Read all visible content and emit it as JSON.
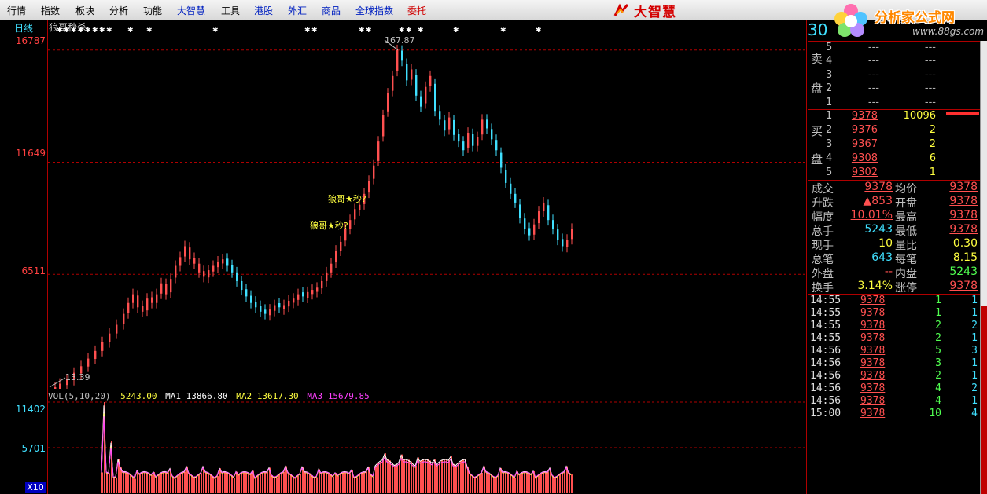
{
  "menu": {
    "items": [
      {
        "label": "行情",
        "style": "normal"
      },
      {
        "label": "指数",
        "style": "normal"
      },
      {
        "label": "板块",
        "style": "normal"
      },
      {
        "label": "分析",
        "style": "normal"
      },
      {
        "label": "功能",
        "style": "normal"
      },
      {
        "label": "大智慧",
        "style": "blue"
      },
      {
        "label": "工具",
        "style": "normal"
      },
      {
        "label": "港股",
        "style": "blue"
      },
      {
        "label": "外汇",
        "style": "blue"
      },
      {
        "label": "商品",
        "style": "blue"
      },
      {
        "label": "全球指数",
        "style": "blue"
      },
      {
        "label": "委托",
        "style": "red"
      }
    ],
    "brand": "大智慧"
  },
  "logo": {
    "title": "分析家公式网",
    "url": "www.88gs.com"
  },
  "chart": {
    "period_tab": "日线",
    "stock_title": "狼哥秒杀",
    "y_labels": [
      "16787",
      "11649",
      "6511"
    ],
    "high_label": "167.87",
    "low_label": "13.39",
    "signal_text": "狼哥★秒?",
    "vol_header": {
      "name": "VOL(5,10,20)",
      "vol": "5243.00",
      "ma1_label": "MA1",
      "ma1": "13866.80",
      "ma2_label": "MA2",
      "ma2": "13617.30",
      "ma3_label": "MA3",
      "ma3": "15679.85"
    },
    "vol_y_labels": [
      "11402",
      "5701"
    ],
    "vol_scale": "X10",
    "colors": {
      "up": "#ff5050",
      "down": "#40e0ff",
      "ma1": "#ffffff",
      "ma2": "#ffff40",
      "ma3": "#ff40ff",
      "grid": "#b00000"
    }
  },
  "chart_data": {
    "type": "candlestick",
    "ylim": [
      1339,
      17500
    ],
    "y_ticks": [
      6511,
      11649,
      16787
    ],
    "high": 16787,
    "low": 1339,
    "vol_ylim": [
      0,
      11402
    ],
    "vol_ticks": [
      5701,
      11402
    ]
  },
  "quote": {
    "code": "30",
    "sell_caption_1": "卖",
    "sell_caption_2": "盘",
    "buy_caption_1": "买",
    "buy_caption_2": "盘",
    "sell": [
      {
        "level": "5",
        "price": "---",
        "vol": "---"
      },
      {
        "level": "4",
        "price": "---",
        "vol": "---"
      },
      {
        "level": "3",
        "price": "---",
        "vol": "---"
      },
      {
        "level": "2",
        "price": "---",
        "vol": "---"
      },
      {
        "level": "1",
        "price": "---",
        "vol": "---"
      }
    ],
    "buy": [
      {
        "level": "1",
        "price": "9378",
        "vol": "10096"
      },
      {
        "level": "2",
        "price": "9376",
        "vol": "2"
      },
      {
        "level": "3",
        "price": "9367",
        "vol": "2"
      },
      {
        "level": "4",
        "price": "9308",
        "vol": "6"
      },
      {
        "level": "5",
        "price": "9302",
        "vol": "1"
      }
    ],
    "info": [
      {
        "l1": "成交",
        "v1": "9378",
        "c1": "red",
        "l2": "均价",
        "v2": "9378",
        "c2": "red"
      },
      {
        "l1": "升跌",
        "v1": "▲853",
        "c1": "red",
        "l2": "开盘",
        "v2": "9378",
        "c2": "red"
      },
      {
        "l1": "幅度",
        "v1": "10.01%",
        "c1": "red",
        "l2": "最高",
        "v2": "9378",
        "c2": "red"
      },
      {
        "l1": "总手",
        "v1": "5243",
        "c1": "cyan",
        "l2": "最低",
        "v2": "9378",
        "c2": "red"
      },
      {
        "l1": "现手",
        "v1": "10",
        "c1": "yellow",
        "l2": "量比",
        "v2": "0.30",
        "c2": "yellow"
      },
      {
        "l1": "总笔",
        "v1": "643",
        "c1": "cyan",
        "l2": "每笔",
        "v2": "8.15",
        "c2": "yellow"
      },
      {
        "l1": "外盘",
        "v1": "--",
        "c1": "red",
        "l2": "内盘",
        "v2": "5243",
        "c2": "green"
      },
      {
        "l1": "换手",
        "v1": "3.14%",
        "c1": "yellow",
        "l2": "涨停",
        "v2": "9378",
        "c2": "red"
      }
    ],
    "ticks": [
      {
        "time": "14:55",
        "price": "9378",
        "vol": "1",
        "n": "1"
      },
      {
        "time": "14:55",
        "price": "9378",
        "vol": "1",
        "n": "1"
      },
      {
        "time": "14:55",
        "price": "9378",
        "vol": "2",
        "n": "2"
      },
      {
        "time": "14:55",
        "price": "9378",
        "vol": "2",
        "n": "1"
      },
      {
        "time": "14:56",
        "price": "9378",
        "vol": "5",
        "n": "3"
      },
      {
        "time": "14:56",
        "price": "9378",
        "vol": "3",
        "n": "1"
      },
      {
        "time": "14:56",
        "price": "9378",
        "vol": "2",
        "n": "1"
      },
      {
        "time": "14:56",
        "price": "9378",
        "vol": "4",
        "n": "2"
      },
      {
        "time": "14:56",
        "price": "9378",
        "vol": "4",
        "n": "1"
      },
      {
        "time": "15:00",
        "price": "9378",
        "vol": "10",
        "n": "4"
      }
    ]
  }
}
